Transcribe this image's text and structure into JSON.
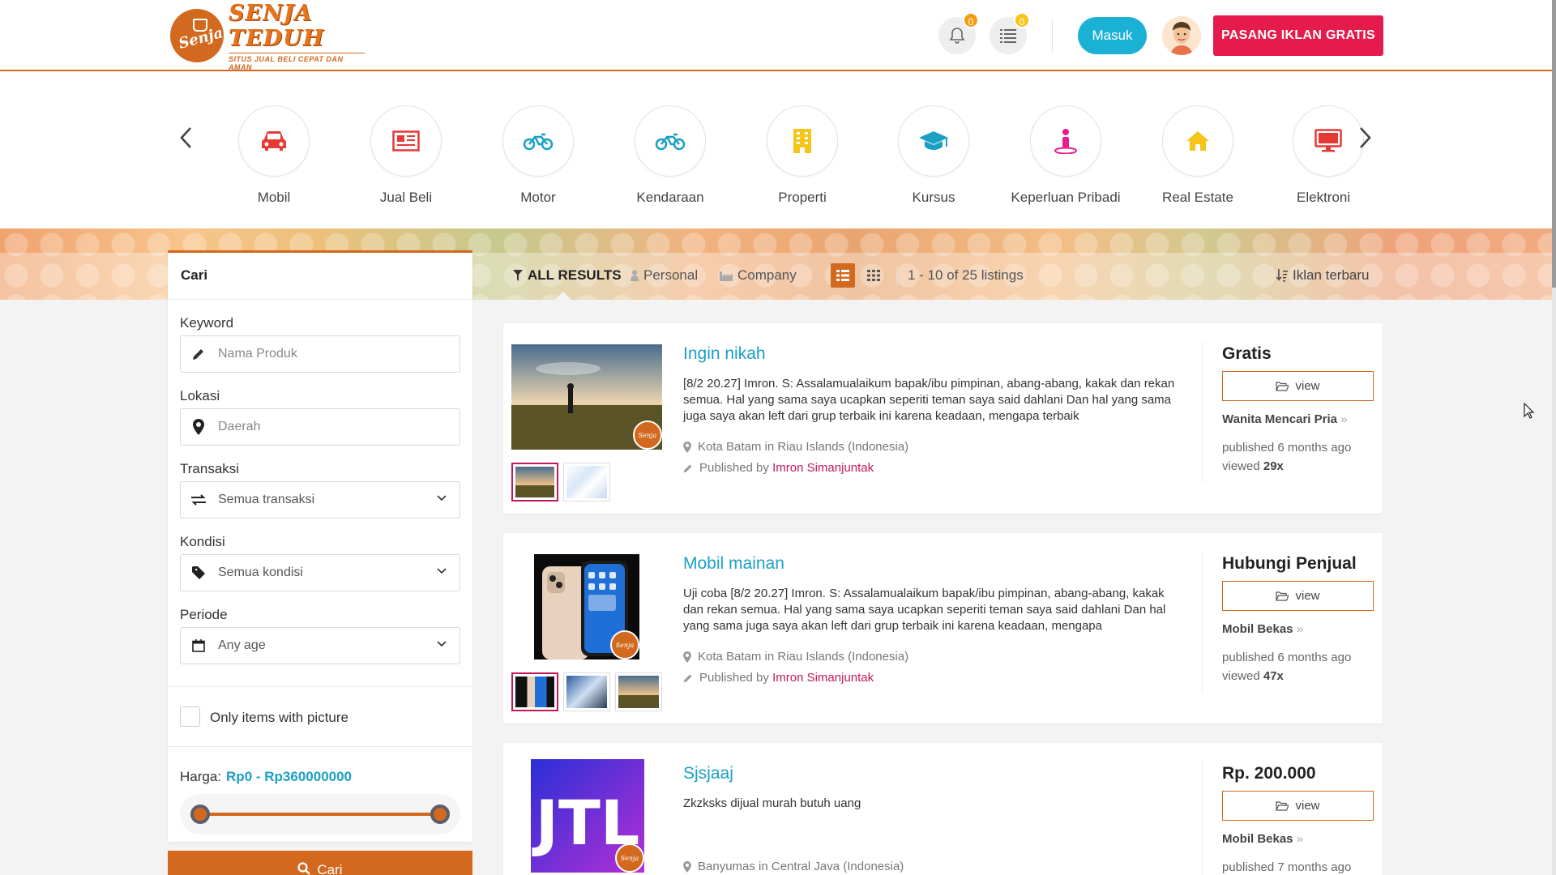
{
  "header": {
    "logo_title": "SENJA TEDUH",
    "logo_subtitle": "SITUS JUAL BELI CEPAT DAN AMAN",
    "logo_script": "Senja",
    "notifications_count": "0",
    "list_count": "0",
    "login_label": "Masuk",
    "post_ad_label": "PASANG IKLAN GRATIS"
  },
  "categories": [
    {
      "label": "Mobil",
      "icon": "car-icon",
      "color": "#e53935"
    },
    {
      "label": "Jual Beli",
      "icon": "newspaper-icon",
      "color": "#e53935"
    },
    {
      "label": "Motor",
      "icon": "motorcycle-icon",
      "color": "#1aa0c4"
    },
    {
      "label": "Kendaraan",
      "icon": "motorcycle-icon",
      "color": "#1aa0c4"
    },
    {
      "label": "Properti",
      "icon": "building-icon",
      "color": "#f5c518"
    },
    {
      "label": "Kursus",
      "icon": "graduation-cap-icon",
      "color": "#1aa0c4"
    },
    {
      "label": "Keperluan Pribadi",
      "icon": "person-icon",
      "color": "#e91e8c"
    },
    {
      "label": "Real Estate",
      "icon": "home-icon",
      "color": "#f5c518"
    },
    {
      "label": "Elektronik",
      "icon": "monitor-icon",
      "color": "#e53935"
    }
  ],
  "sidebar": {
    "title": "Cari",
    "keyword_label": "Keyword",
    "keyword_placeholder": "Nama Produk",
    "location_label": "Lokasi",
    "location_placeholder": "Daerah",
    "transaction_label": "Transaksi",
    "transaction_value": "Semua transaksi",
    "condition_label": "Kondisi",
    "condition_value": "Semua kondisi",
    "period_label": "Periode",
    "period_value": "Any age",
    "picture_only_label": "Only items with picture",
    "price_label": "Harga:",
    "price_range": "Rp0 - Rp360000000",
    "search_button": "Cari"
  },
  "toolbar": {
    "all_results": "ALL RESULTS",
    "personal": "Personal",
    "company": "Company",
    "count_text": "1 - 10 of 25 listings",
    "sort_label": "Iklan terbaru"
  },
  "listings": [
    {
      "title": "Ingin nikah",
      "description": "[8/2 20.27] Imron. S: Assalamualaikum bapak/ibu pimpinan, abang-abang, kakak dan rekan semua. Hal yang sama saya ucapkan seperiti teman saya said dahlani Dan hal yang sama juga saya akan left dari grup terbaik ini karena keadaan, mengapa terbaik",
      "location": "Kota Batam in Riau Islands (Indonesia)",
      "published_prefix": "Published by",
      "author": "Imron Simanjuntak",
      "price": "Gratis",
      "view_label": "view",
      "category": "Wanita Mencari Pria",
      "published": "published 6 months ago",
      "viewed_prefix": "viewed",
      "viewed": "29x"
    },
    {
      "title": "Mobil mainan",
      "description": "Uji coba [8/2 20.27] Imron. S: Assalamualaikum bapak/ibu pimpinan, abang-abang, kakak dan rekan semua. Hal yang sama saya ucapkan seperiti teman saya said dahlani Dan hal yang sama juga saya akan left dari grup terbaik ini karena keadaan, mengapa",
      "location": "Kota Batam in Riau Islands (Indonesia)",
      "published_prefix": "Published by",
      "author": "Imron Simanjuntak",
      "price": "Hubungi Penjual",
      "view_label": "view",
      "category": "Mobil Bekas",
      "published": "published 6 months ago",
      "viewed_prefix": "viewed",
      "viewed": "47x"
    },
    {
      "title": "Sjsjaaj",
      "description": "Zkzksks dijual murah butuh uang",
      "location": "Banyumas in Central Java (Indonesia)",
      "price": "Rp. 200.000",
      "view_label": "view",
      "category": "Mobil Bekas",
      "published": "published 7 months ago",
      "thumb_text": "JTL"
    }
  ]
}
